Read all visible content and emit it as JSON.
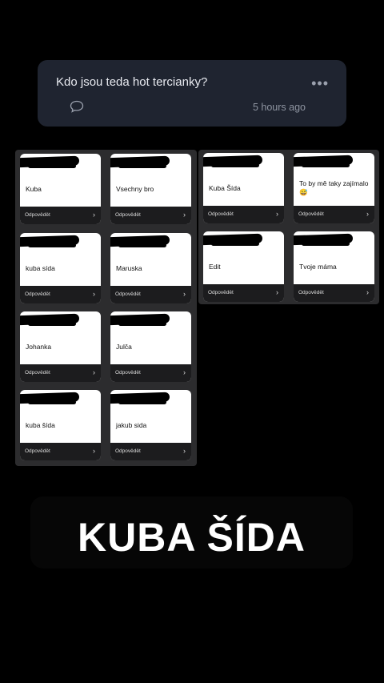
{
  "question": {
    "text": "Kdo jsou teda hot tercianky?",
    "more_icon": "more-dots-icon",
    "comment_icon": "comment-icon",
    "time": "5 hours ago"
  },
  "reply_label": "Odpovědět",
  "left_panel": {
    "cards": [
      {
        "answer": "Kuba"
      },
      {
        "answer": "Vsechny bro"
      },
      {
        "answer": "kuba sída"
      },
      {
        "answer": "Maruska"
      },
      {
        "answer": "Johanka"
      },
      {
        "answer": "Julča"
      },
      {
        "answer": "kuba šída"
      },
      {
        "answer": "jakub sida"
      }
    ]
  },
  "right_panel": {
    "cards": [
      {
        "answer": "Kuba Šída"
      },
      {
        "answer": "To by mě taky zajímalo 😅"
      },
      {
        "answer": "Edit"
      },
      {
        "answer": "Tvoje máma"
      }
    ]
  },
  "big_caption": "KUBA ŠÍDA"
}
